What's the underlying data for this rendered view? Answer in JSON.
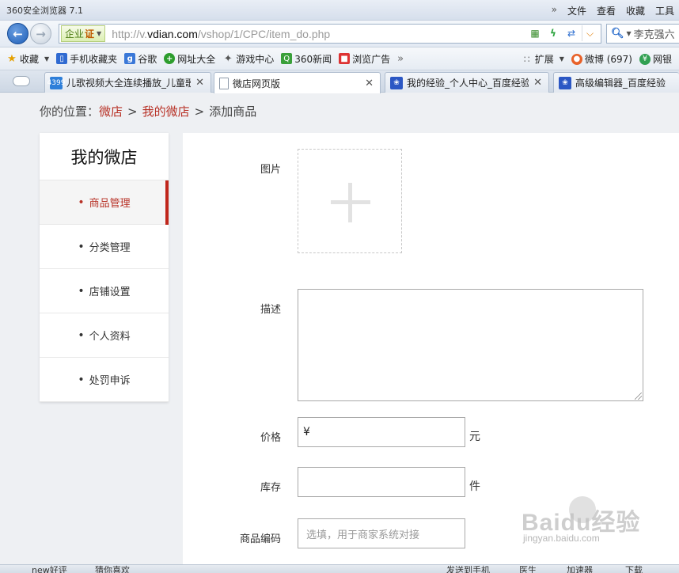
{
  "browser": {
    "app_title": "360安全浏览器 7.1",
    "menu": [
      "文件",
      "查看",
      "收藏",
      "工具"
    ],
    "more_glyph": "»",
    "cert_label": "企业",
    "cert_mark": "证",
    "url_prefix": "http://v.",
    "url_domain": "vdian.com",
    "url_path": "/vshop/1/CPC/item_do.php",
    "search_text": "李克强六"
  },
  "favorites": {
    "left": [
      {
        "label": "收藏",
        "icon": "star-icon",
        "caret": true
      },
      {
        "label": "手机收藏夹",
        "icon": "phone-icon"
      },
      {
        "label": "谷歌",
        "icon": "google-icon"
      },
      {
        "label": "网址大全",
        "icon": "plus-circle-icon"
      },
      {
        "label": "游戏中心",
        "icon": "gamepad-icon"
      },
      {
        "label": "360新闻",
        "icon": "news-icon"
      },
      {
        "label": "浏览广告",
        "icon": "ad-icon"
      }
    ],
    "overflow_glyph": "»",
    "right": [
      {
        "label": "扩展",
        "icon": "extensions-icon",
        "caret": true
      },
      {
        "label": "微博 (697)",
        "icon": "weibo-icon"
      },
      {
        "label": "网银",
        "icon": "bank-icon"
      }
    ]
  },
  "tabs": [
    {
      "label": "儿歌视频大全连续播放_儿童歌",
      "icon": "4399-icon",
      "active": false
    },
    {
      "label": "微店网页版",
      "icon": "page-icon",
      "active": true
    },
    {
      "label": "我的经验_个人中心_百度经验",
      "icon": "baidu-paw-icon",
      "active": false
    },
    {
      "label": "高级编辑器_百度经验",
      "icon": "baidu-paw-icon",
      "active": false
    }
  ],
  "breadcrumb": {
    "prefix": "你的位置：",
    "link1": "微店",
    "link2": "我的微店",
    "current": "添加商品",
    "separator": ">"
  },
  "sidebar": {
    "title": "我的微店",
    "items": [
      {
        "label": "商品管理",
        "active": true
      },
      {
        "label": "分类管理",
        "active": false
      },
      {
        "label": "店铺设置",
        "active": false
      },
      {
        "label": "个人资料",
        "active": false
      },
      {
        "label": "处罚申诉",
        "active": false
      }
    ]
  },
  "form": {
    "image_label": "图片",
    "desc_label": "描述",
    "desc_value": "",
    "price_label": "价格",
    "price_value": "¥",
    "price_unit": "元",
    "stock_label": "库存",
    "stock_value": "",
    "stock_unit": "件",
    "code_label": "商品编码",
    "code_placeholder": "选填，用于商家系统对接"
  },
  "watermark": {
    "logo": "Baidu经验",
    "sub": "jingyan.baidu.com"
  },
  "statusbar": [
    "new好评",
    "猜你喜欢",
    "发送到手机",
    "医生",
    "加速器",
    "下载"
  ],
  "colors": {
    "accent_red": "#c0261b",
    "link_red": "#b83227",
    "page_bg": "#eef0f3"
  }
}
